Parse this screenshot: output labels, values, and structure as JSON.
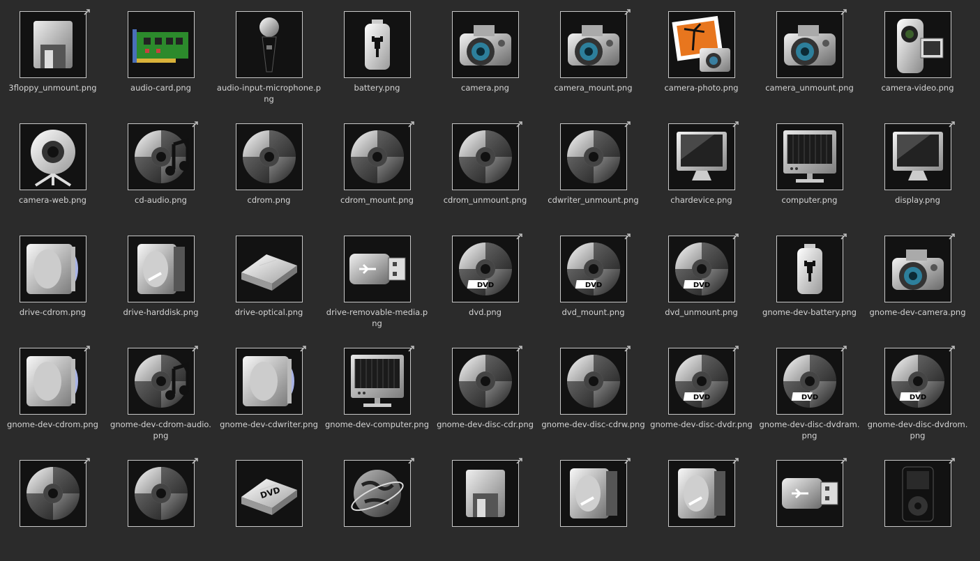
{
  "files": [
    {
      "label": "3floppy_unmount.\npng",
      "icon": "floppy-icon",
      "link": true
    },
    {
      "label": "audio-card.png",
      "icon": "audio-card-icon",
      "link": false
    },
    {
      "label": "audio-input-\nmicrophone.png",
      "icon": "microphone-icon",
      "link": false
    },
    {
      "label": "battery.png",
      "icon": "battery-icon",
      "link": false
    },
    {
      "label": "camera.png",
      "icon": "camera-icon",
      "link": false
    },
    {
      "label": "camera_mount.png",
      "icon": "camera-icon",
      "link": true
    },
    {
      "label": "camera-photo.png",
      "icon": "camera-photo-icon",
      "link": false
    },
    {
      "label": "camera_unmount.\npng",
      "icon": "camera-icon",
      "link": true
    },
    {
      "label": "camera-video.png",
      "icon": "camcorder-icon",
      "link": false
    },
    {
      "label": "camera-web.png",
      "icon": "webcam-icon",
      "link": false
    },
    {
      "label": "cd-audio.png",
      "icon": "cd-audio-icon",
      "link": true
    },
    {
      "label": "cdrom.png",
      "icon": "disc-icon",
      "link": false
    },
    {
      "label": "cdrom_mount.png",
      "icon": "disc-icon",
      "link": true
    },
    {
      "label": "cdrom_unmount.png",
      "icon": "disc-icon",
      "link": true
    },
    {
      "label": "cdwriter_unmount.\npng",
      "icon": "disc-icon",
      "link": true
    },
    {
      "label": "chardevice.png",
      "icon": "monitor-icon",
      "link": true
    },
    {
      "label": "computer.png",
      "icon": "computer-icon",
      "link": false
    },
    {
      "label": "display.png",
      "icon": "monitor-icon",
      "link": true
    },
    {
      "label": "drive-cdrom.png",
      "icon": "drive-cdrom-icon",
      "link": false
    },
    {
      "label": "drive-harddisk.png",
      "icon": "drive-harddisk-icon",
      "link": false
    },
    {
      "label": "drive-optical.png",
      "icon": "drive-optical-icon",
      "link": false
    },
    {
      "label": "drive-removable-\nmedia.png",
      "icon": "usb-drive-icon",
      "link": false
    },
    {
      "label": "dvd.png",
      "icon": "dvd-icon",
      "link": true
    },
    {
      "label": "dvd_mount.png",
      "icon": "dvd-icon",
      "link": true
    },
    {
      "label": "dvd_unmount.png",
      "icon": "dvd-icon",
      "link": true
    },
    {
      "label": "gnome-dev-battery.\npng",
      "icon": "battery-icon",
      "link": true
    },
    {
      "label": "gnome-dev-camera.\npng",
      "icon": "camera-icon",
      "link": true
    },
    {
      "label": "gnome-dev-cdrom.\npng",
      "icon": "drive-cdrom-icon",
      "link": true
    },
    {
      "label": "gnome-dev-cdrom-\naudio.png",
      "icon": "cd-audio-icon",
      "link": true
    },
    {
      "label": "gnome-dev-\ncdwriter.png",
      "icon": "drive-cdrom-icon",
      "link": true
    },
    {
      "label": "gnome-dev-\ncomputer.png",
      "icon": "computer-icon",
      "link": true
    },
    {
      "label": "gnome-dev-disc-cdr.\npng",
      "icon": "disc-icon",
      "link": true
    },
    {
      "label": "gnome-dev-disc-\ncdrw.png",
      "icon": "disc-icon",
      "link": true
    },
    {
      "label": "gnome-dev-disc-\ndvdr.png",
      "icon": "dvd-icon",
      "link": true
    },
    {
      "label": "gnome-dev-disc-\ndvdram.png",
      "icon": "dvd-icon",
      "link": true
    },
    {
      "label": "gnome-dev-disc-\ndvdrom.png",
      "icon": "dvd-icon",
      "link": true
    },
    {
      "label": "",
      "icon": "disc-icon",
      "link": true
    },
    {
      "label": "",
      "icon": "disc-icon",
      "link": true
    },
    {
      "label": "",
      "icon": "drive-optical-dvd-icon",
      "link": false
    },
    {
      "label": "",
      "icon": "globe-icon",
      "link": true
    },
    {
      "label": "",
      "icon": "floppy-icon",
      "link": true
    },
    {
      "label": "",
      "icon": "drive-harddisk-icon",
      "link": true
    },
    {
      "label": "",
      "icon": "drive-harddisk-icon",
      "link": true
    },
    {
      "label": "",
      "icon": "usb-drive-icon",
      "link": true
    },
    {
      "label": "",
      "icon": "media-player-icon",
      "link": true
    }
  ]
}
